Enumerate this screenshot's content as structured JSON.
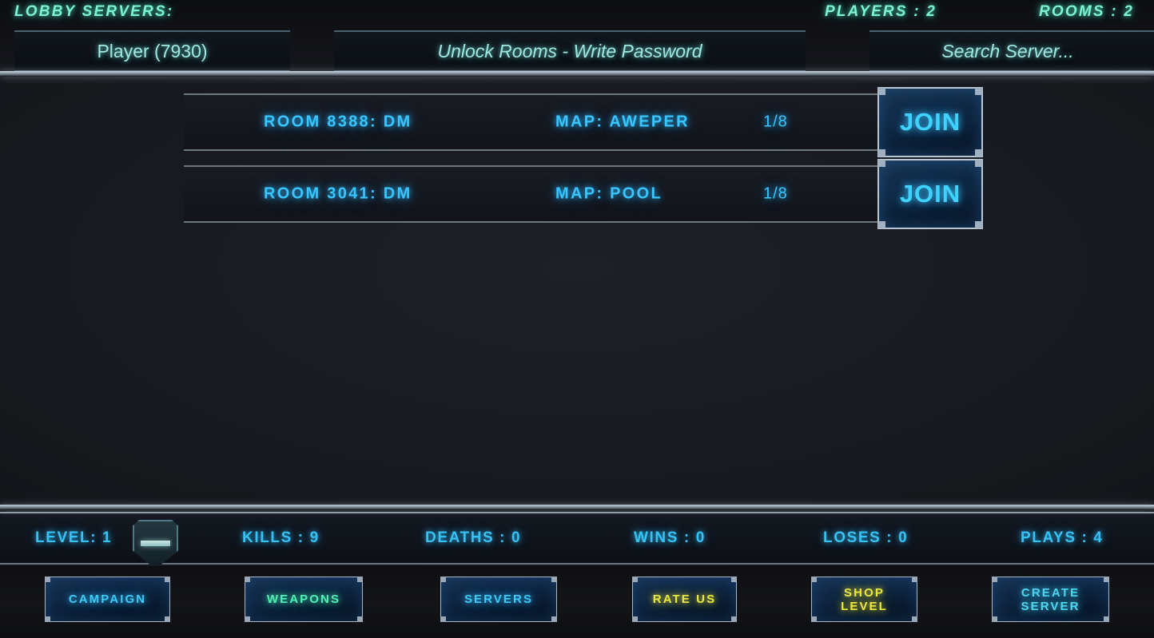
{
  "header": {
    "lobby_title": "LOBBY SERVERS:",
    "players_count": "PLAYERS : 2",
    "rooms_count": "ROOMS : 2",
    "player_field": {
      "value": "Player (7930)"
    },
    "password_field": {
      "placeholder": "Unlock Rooms - Write Password"
    },
    "search_field": {
      "placeholder": "Search  Server..."
    }
  },
  "rooms": [
    {
      "name": "ROOM 8388: DM",
      "map": "MAP: AWEPER",
      "capacity": "1/8",
      "join_label": "JOIN"
    },
    {
      "name": "ROOM 3041: DM",
      "map": "MAP: POOL",
      "capacity": "1/8",
      "join_label": "JOIN"
    }
  ],
  "stats": {
    "level": "LEVEL: 1",
    "kills": "KILLS : 9",
    "deaths": "DEATHS : 0",
    "wins": "WINS : 0",
    "loses": "LOSES : 0",
    "plays": "PLAYS : 4"
  },
  "nav_buttons": [
    {
      "label": "CAMPAIGN",
      "color": "#3fc9f7"
    },
    {
      "label": "WEAPONS",
      "color": "#53f0b4"
    },
    {
      "label": "SERVERS",
      "color": "#3fc9f7"
    },
    {
      "label": "RATE US",
      "color": "#ebe93f"
    },
    {
      "label": "SHOP\nLEVEL",
      "color": "#ebe93f"
    },
    {
      "label": "CREATE\nSERVER",
      "color": "#4fd8f2"
    }
  ],
  "colors": {
    "accent_blue": "#3fc9f7",
    "accent_teal": "#7df3d3",
    "accent_green": "#53f0b4",
    "accent_yellow": "#ebe93f",
    "accent_cyan": "#4fd8f2",
    "background": "#16181d",
    "panel": "#191c22",
    "border_light": "#b9c6d4"
  }
}
